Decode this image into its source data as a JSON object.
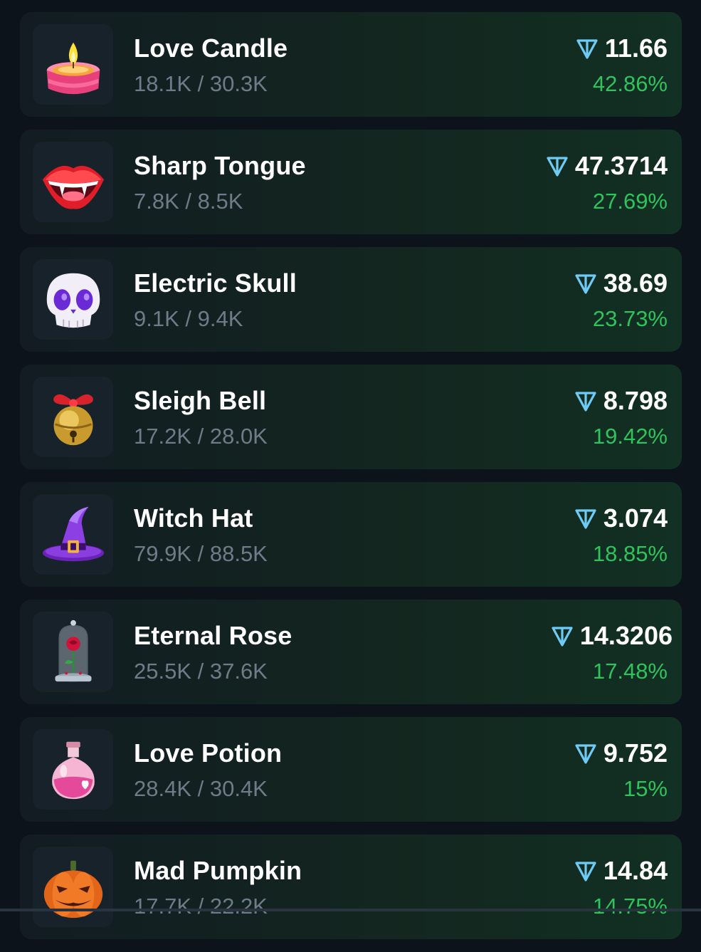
{
  "items": [
    {
      "name": "Love Candle",
      "supply": "18.1K / 30.3K",
      "price": "11.66",
      "change": "42.86%",
      "icon": "love-candle-icon"
    },
    {
      "name": "Sharp Tongue",
      "supply": "7.8K / 8.5K",
      "price": "47.3714",
      "change": "27.69%",
      "icon": "sharp-tongue-icon"
    },
    {
      "name": "Electric Skull",
      "supply": "9.1K / 9.4K",
      "price": "38.69",
      "change": "23.73%",
      "icon": "electric-skull-icon"
    },
    {
      "name": "Sleigh Bell",
      "supply": "17.2K / 28.0K",
      "price": "8.798",
      "change": "19.42%",
      "icon": "sleigh-bell-icon"
    },
    {
      "name": "Witch Hat",
      "supply": "79.9K / 88.5K",
      "price": "3.074",
      "change": "18.85%",
      "icon": "witch-hat-icon"
    },
    {
      "name": "Eternal Rose",
      "supply": "25.5K / 37.6K",
      "price": "14.3206",
      "change": "17.48%",
      "icon": "eternal-rose-icon"
    },
    {
      "name": "Love Potion",
      "supply": "28.4K / 30.4K",
      "price": "9.752",
      "change": "15%",
      "icon": "love-potion-icon"
    },
    {
      "name": "Mad Pumpkin",
      "supply": "17.7K / 22.2K",
      "price": "14.84",
      "change": "14.75%",
      "icon": "mad-pumpkin-icon"
    }
  ],
  "colors": {
    "background": "#0d131a",
    "card": "#13261f",
    "positive": "#30c25c",
    "muted": "#6f7b89",
    "ton": "#6ecbf5"
  },
  "currency_icon": "ton-diamond-icon"
}
